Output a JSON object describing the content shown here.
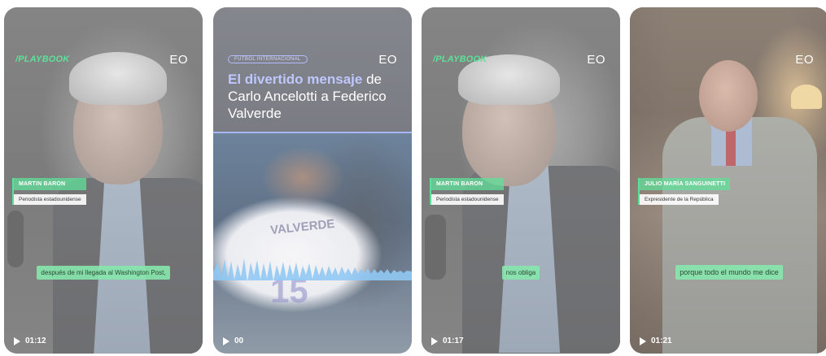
{
  "cards": [
    {
      "brand": "/PLAYBOOK",
      "logo": "EO",
      "name": "MARTIN BARON",
      "role": "Periodista estadounidense",
      "subtitle": "después de mi llegada al Washington Post,",
      "duration": "01:12"
    },
    {
      "tag": "FUTBOL INTERNACIONAL",
      "logo": "EO",
      "title_highlight": "El divertido mensaje",
      "title_rest": " de Carlo Ancelotti a Federico Valverde",
      "jersey_name": "VALVERDE",
      "jersey_number": "15",
      "duration": "00"
    },
    {
      "brand": "/PLAYBOOK",
      "logo": "EO",
      "name": "MARTIN BARON",
      "role": "Periodista estadounidense",
      "subtitle": "nos obliga",
      "duration": "01:17"
    },
    {
      "logo": "EO",
      "name": "JULIO MARÍA SANGUINETTI",
      "role": "Expresidente de la República",
      "subtitle": "porque todo el mundo me dice",
      "duration": "01:21"
    }
  ],
  "colors": {
    "accent_green": "#5fe09a",
    "accent_blue": "#8d9bff"
  },
  "icons": [
    "play-icon"
  ]
}
